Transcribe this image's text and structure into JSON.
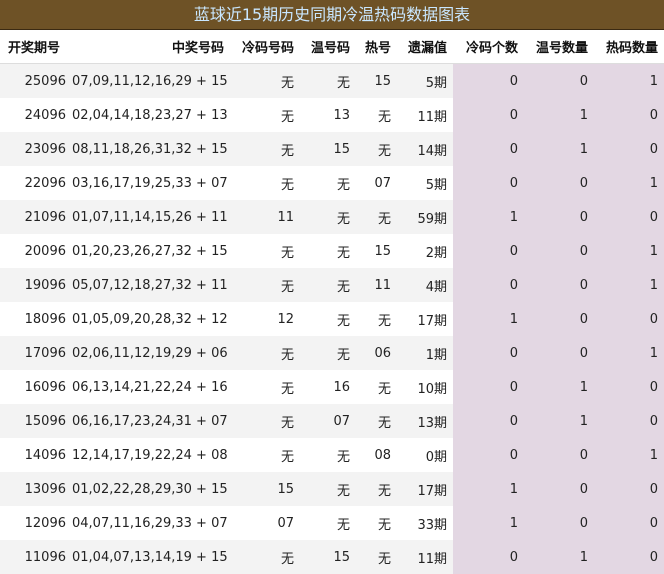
{
  "title": "蓝球近15期历史同期冷温热码数据图表",
  "headers": [
    "开奖期号",
    "中奖号码",
    "冷码号码",
    "温号码",
    "热号",
    "遗漏值",
    "冷码个数",
    "温号数量",
    "热码数量"
  ],
  "rows": [
    {
      "period": "25096",
      "numbers": "07,09,11,12,16,29 + 15",
      "cold": "无",
      "warm": "无",
      "hot": "15",
      "omit": "5期",
      "cold_count": "0",
      "warm_count": "0",
      "hot_count": "1"
    },
    {
      "period": "24096",
      "numbers": "02,04,14,18,23,27 + 13",
      "cold": "无",
      "warm": "13",
      "hot": "无",
      "omit": "11期",
      "cold_count": "0",
      "warm_count": "1",
      "hot_count": "0"
    },
    {
      "period": "23096",
      "numbers": "08,11,18,26,31,32 + 15",
      "cold": "无",
      "warm": "15",
      "hot": "无",
      "omit": "14期",
      "cold_count": "0",
      "warm_count": "1",
      "hot_count": "0"
    },
    {
      "period": "22096",
      "numbers": "03,16,17,19,25,33 + 07",
      "cold": "无",
      "warm": "无",
      "hot": "07",
      "omit": "5期",
      "cold_count": "0",
      "warm_count": "0",
      "hot_count": "1"
    },
    {
      "period": "21096",
      "numbers": "01,07,11,14,15,26 + 11",
      "cold": "11",
      "warm": "无",
      "hot": "无",
      "omit": "59期",
      "cold_count": "1",
      "warm_count": "0",
      "hot_count": "0"
    },
    {
      "period": "20096",
      "numbers": "01,20,23,26,27,32 + 15",
      "cold": "无",
      "warm": "无",
      "hot": "15",
      "omit": "2期",
      "cold_count": "0",
      "warm_count": "0",
      "hot_count": "1"
    },
    {
      "period": "19096",
      "numbers": "05,07,12,18,27,32 + 11",
      "cold": "无",
      "warm": "无",
      "hot": "11",
      "omit": "4期",
      "cold_count": "0",
      "warm_count": "0",
      "hot_count": "1"
    },
    {
      "period": "18096",
      "numbers": "01,05,09,20,28,32 + 12",
      "cold": "12",
      "warm": "无",
      "hot": "无",
      "omit": "17期",
      "cold_count": "1",
      "warm_count": "0",
      "hot_count": "0"
    },
    {
      "period": "17096",
      "numbers": "02,06,11,12,19,29 + 06",
      "cold": "无",
      "warm": "无",
      "hot": "06",
      "omit": "1期",
      "cold_count": "0",
      "warm_count": "0",
      "hot_count": "1"
    },
    {
      "period": "16096",
      "numbers": "06,13,14,21,22,24 + 16",
      "cold": "无",
      "warm": "16",
      "hot": "无",
      "omit": "10期",
      "cold_count": "0",
      "warm_count": "1",
      "hot_count": "0"
    },
    {
      "period": "15096",
      "numbers": "06,16,17,23,24,31 + 07",
      "cold": "无",
      "warm": "07",
      "hot": "无",
      "omit": "13期",
      "cold_count": "0",
      "warm_count": "1",
      "hot_count": "0"
    },
    {
      "period": "14096",
      "numbers": "12,14,17,19,22,24 + 08",
      "cold": "无",
      "warm": "无",
      "hot": "08",
      "omit": "0期",
      "cold_count": "0",
      "warm_count": "0",
      "hot_count": "1"
    },
    {
      "period": "13096",
      "numbers": "01,02,22,28,29,30 + 15",
      "cold": "15",
      "warm": "无",
      "hot": "无",
      "omit": "17期",
      "cold_count": "1",
      "warm_count": "0",
      "hot_count": "0"
    },
    {
      "period": "12096",
      "numbers": "04,07,11,16,29,33 + 07",
      "cold": "07",
      "warm": "无",
      "hot": "无",
      "omit": "33期",
      "cold_count": "1",
      "warm_count": "0",
      "hot_count": "0"
    },
    {
      "period": "11096",
      "numbers": "01,04,07,13,14,19 + 15",
      "cold": "无",
      "warm": "15",
      "hot": "无",
      "omit": "11期",
      "cold_count": "0",
      "warm_count": "1",
      "hot_count": "0"
    }
  ]
}
